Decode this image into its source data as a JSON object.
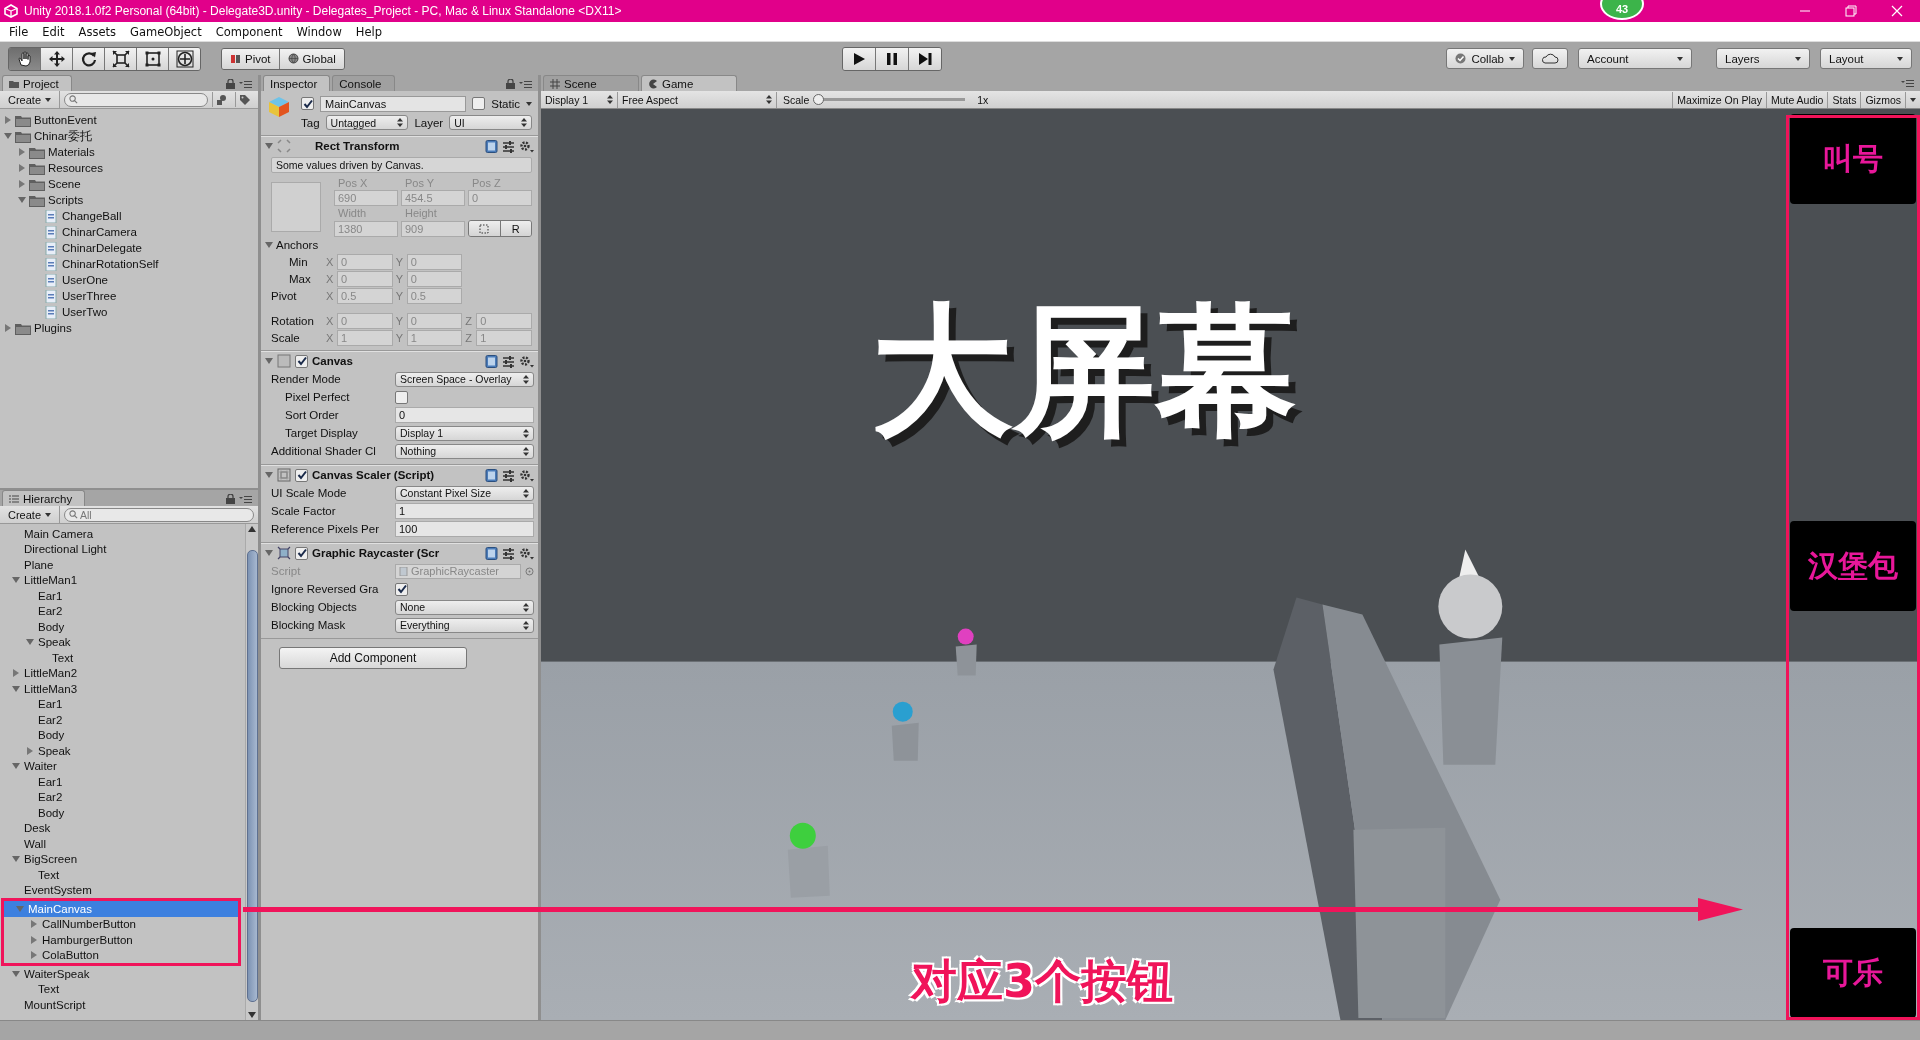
{
  "window": {
    "title": "Unity 2018.1.0f2 Personal (64bit) - Delegate3D.unity - Delegates_Project - PC, Mac & Linux Standalone <DX11>",
    "badge": "43"
  },
  "menu": [
    "File",
    "Edit",
    "Assets",
    "GameObject",
    "Component",
    "Window",
    "Help"
  ],
  "toolbar": {
    "tools": [
      {
        "kind": "hand",
        "selected": true
      },
      {
        "kind": "move",
        "selected": false
      },
      {
        "kind": "rotate",
        "selected": false
      },
      {
        "kind": "scale",
        "selected": false
      },
      {
        "kind": "rect",
        "selected": false
      },
      {
        "kind": "transform",
        "selected": false
      }
    ],
    "pivot": "Pivot",
    "global": "Global",
    "playback": [
      {
        "kind": "play"
      },
      {
        "kind": "pause"
      },
      {
        "kind": "step"
      }
    ],
    "collab": "Collab",
    "account": "Account",
    "layers": "Layers",
    "layout": "Layout"
  },
  "project": {
    "tab": "Project",
    "create": "Create",
    "tree": [
      {
        "label": "ButtonEvent",
        "kind": "folder",
        "expanded": false
      },
      {
        "label": "Chinar委托",
        "kind": "folder",
        "expanded": true,
        "children": [
          {
            "label": "Materials",
            "kind": "folder",
            "expanded": false
          },
          {
            "label": "Resources",
            "kind": "folder",
            "expanded": false
          },
          {
            "label": "Scene",
            "kind": "folder",
            "expanded": false
          },
          {
            "label": "Scripts",
            "kind": "folder",
            "expanded": true,
            "children": [
              {
                "label": "ChangeBall",
                "kind": "script"
              },
              {
                "label": "ChinarCamera",
                "kind": "script"
              },
              {
                "label": "ChinarDelegate",
                "kind": "script"
              },
              {
                "label": "ChinarRotationSelf",
                "kind": "script"
              },
              {
                "label": "UserOne",
                "kind": "script"
              },
              {
                "label": "UserThree",
                "kind": "script"
              },
              {
                "label": "UserTwo",
                "kind": "script"
              }
            ]
          }
        ]
      },
      {
        "label": "Plugins",
        "kind": "folder",
        "expanded": false
      }
    ]
  },
  "hierarchy": {
    "tab": "Hierarchy",
    "create": "Create",
    "placeholder": "All",
    "tree": [
      {
        "label": "Main Camera",
        "selected": false
      },
      {
        "label": "Directional Light",
        "selected": false
      },
      {
        "label": "Plane",
        "selected": false
      },
      {
        "label": "LittleMan1",
        "selected": false,
        "expanded": true,
        "children": [
          {
            "label": "Ear1",
            "selected": false
          },
          {
            "label": "Ear2",
            "selected": false
          },
          {
            "label": "Body",
            "selected": false
          },
          {
            "label": "Speak",
            "selected": false,
            "expanded": true,
            "children": [
              {
                "label": "Text",
                "selected": false
              }
            ]
          }
        ]
      },
      {
        "label": "LittleMan2",
        "selected": false,
        "expanded": false
      },
      {
        "label": "LittleMan3",
        "selected": false,
        "expanded": true,
        "children": [
          {
            "label": "Ear1",
            "selected": false
          },
          {
            "label": "Ear2",
            "selected": false
          },
          {
            "label": "Body",
            "selected": false
          },
          {
            "label": "Speak",
            "selected": false,
            "expanded": false
          }
        ]
      },
      {
        "label": "Waiter",
        "selected": false,
        "expanded": true,
        "children": [
          {
            "label": "Ear1",
            "selected": false
          },
          {
            "label": "Ear2",
            "selected": false
          },
          {
            "label": "Body",
            "selected": false
          }
        ]
      },
      {
        "label": "Desk",
        "selected": false
      },
      {
        "label": "Wall",
        "selected": false
      },
      {
        "label": "BigScreen",
        "selected": false,
        "expanded": true,
        "children": [
          {
            "label": "Text",
            "selected": false
          }
        ]
      },
      {
        "label": "EventSystem",
        "selected": false
      },
      {
        "label": "MainCanvas",
        "selected": true,
        "expanded": true,
        "children": [
          {
            "label": "CallNumberButton",
            "selected": false,
            "expanded": false
          },
          {
            "label": "HamburgerButton",
            "selected": false,
            "expanded": false
          },
          {
            "label": "ColaButton",
            "selected": false,
            "expanded": false
          }
        ]
      },
      {
        "label": "WaiterSpeak",
        "selected": false,
        "expanded": true,
        "children": [
          {
            "label": "Text",
            "selected": false
          }
        ]
      },
      {
        "label": "MountScript",
        "selected": false
      }
    ]
  },
  "inspector": {
    "tabs": [
      {
        "label": "Inspector",
        "selected": true
      },
      {
        "label": "Console",
        "selected": false
      }
    ],
    "object": {
      "active": true,
      "name": "MainCanvas",
      "static": false,
      "static_label": "Static",
      "tag_label": "Tag",
      "tag": "Untagged",
      "layer_label": "Layer",
      "layer": "UI"
    },
    "rect_transform": {
      "title": "Rect Transform",
      "note": "Some values driven by Canvas.",
      "pos": [
        {
          "label": "Pos X",
          "value": "690"
        },
        {
          "label": "Pos Y",
          "value": "454.5"
        },
        {
          "label": "Pos Z",
          "value": "0"
        }
      ],
      "size": [
        {
          "label": "Width",
          "value": "1380"
        },
        {
          "label": "Height",
          "value": "909"
        }
      ],
      "raw_button": "R",
      "anchors": {
        "label": "Anchors",
        "expanded": true,
        "rows": [
          {
            "label": "Min",
            "axes": [
              {
                "axis": "X",
                "value": "0"
              },
              {
                "axis": "Y",
                "value": "0"
              }
            ]
          },
          {
            "label": "Max",
            "axes": [
              {
                "axis": "X",
                "value": "0"
              },
              {
                "axis": "Y",
                "value": "0"
              }
            ]
          }
        ]
      },
      "pivot": {
        "label": "Pivot",
        "axes": [
          {
            "axis": "X",
            "value": "0.5"
          },
          {
            "axis": "Y",
            "value": "0.5"
          }
        ]
      },
      "transform_rows": [
        {
          "label": "Rotation",
          "axes": [
            {
              "axis": "X",
              "value": "0"
            },
            {
              "axis": "Y",
              "value": "0"
            },
            {
              "axis": "Z",
              "value": "0"
            }
          ]
        },
        {
          "label": "Scale",
          "axes": [
            {
              "axis": "X",
              "value": "1"
            },
            {
              "axis": "Y",
              "value": "1"
            },
            {
              "axis": "Z",
              "value": "1"
            }
          ]
        }
      ]
    },
    "components": [
      {
        "title": "Canvas",
        "kind": "canvas",
        "enabled": true,
        "rows": [
          {
            "label": "Render Mode",
            "kind": "dropdown",
            "value": "Screen Space - Overlay",
            "children": [
              {
                "label": "Pixel Perfect",
                "kind": "checkbox",
                "checked": false
              },
              {
                "label": "Sort Order",
                "kind": "field",
                "value": "0"
              },
              {
                "label": "Target Display",
                "kind": "dropdown",
                "value": "Display 1"
              }
            ]
          },
          {
            "label": "Additional Shader Cl",
            "kind": "dropdown",
            "value": "Nothing"
          }
        ]
      },
      {
        "title": "Canvas Scaler (Script)",
        "kind": "scaler",
        "enabled": true,
        "rows": [
          {
            "label": "UI Scale Mode",
            "kind": "dropdown",
            "value": "Constant Pixel Size"
          },
          {
            "label": "Scale Factor",
            "kind": "field",
            "value": "1"
          },
          {
            "label": "Reference Pixels Per",
            "kind": "field",
            "value": "100"
          }
        ]
      },
      {
        "title": "Graphic Raycaster (Scr",
        "kind": "raycaster",
        "enabled": true,
        "rows": [
          {
            "label": "Script",
            "kind": "object",
            "value": "GraphicRaycaster"
          },
          {
            "label": "Ignore Reversed Gra",
            "kind": "checkbox",
            "checked": true
          },
          {
            "label": "Blocking Objects",
            "kind": "dropdown",
            "value": "None"
          },
          {
            "label": "Blocking Mask",
            "kind": "dropdown",
            "value": "Everything"
          }
        ]
      }
    ],
    "add_component": "Add Component"
  },
  "game": {
    "tabs": [
      {
        "label": "Scene",
        "selected": false
      },
      {
        "label": "Game",
        "selected": true
      }
    ],
    "display": "Display 1",
    "aspect": "Free Aspect",
    "scale_label": "Scale",
    "scale": {
      "level": 0.02,
      "reading": "1x"
    },
    "toggles": [
      {
        "label": "Maximize On Play",
        "on": false
      },
      {
        "label": "Mute Audio",
        "on": false
      },
      {
        "label": "Stats",
        "on": false
      },
      {
        "label": "Gizmos",
        "on": false
      }
    ],
    "view": {
      "kind": "picture",
      "big_screen_text": "大屏幕",
      "ui_buttons": [
        "叫号",
        "汉堡包",
        "可乐"
      ]
    }
  },
  "annotations": {
    "caption": "对应3个按钮"
  }
}
